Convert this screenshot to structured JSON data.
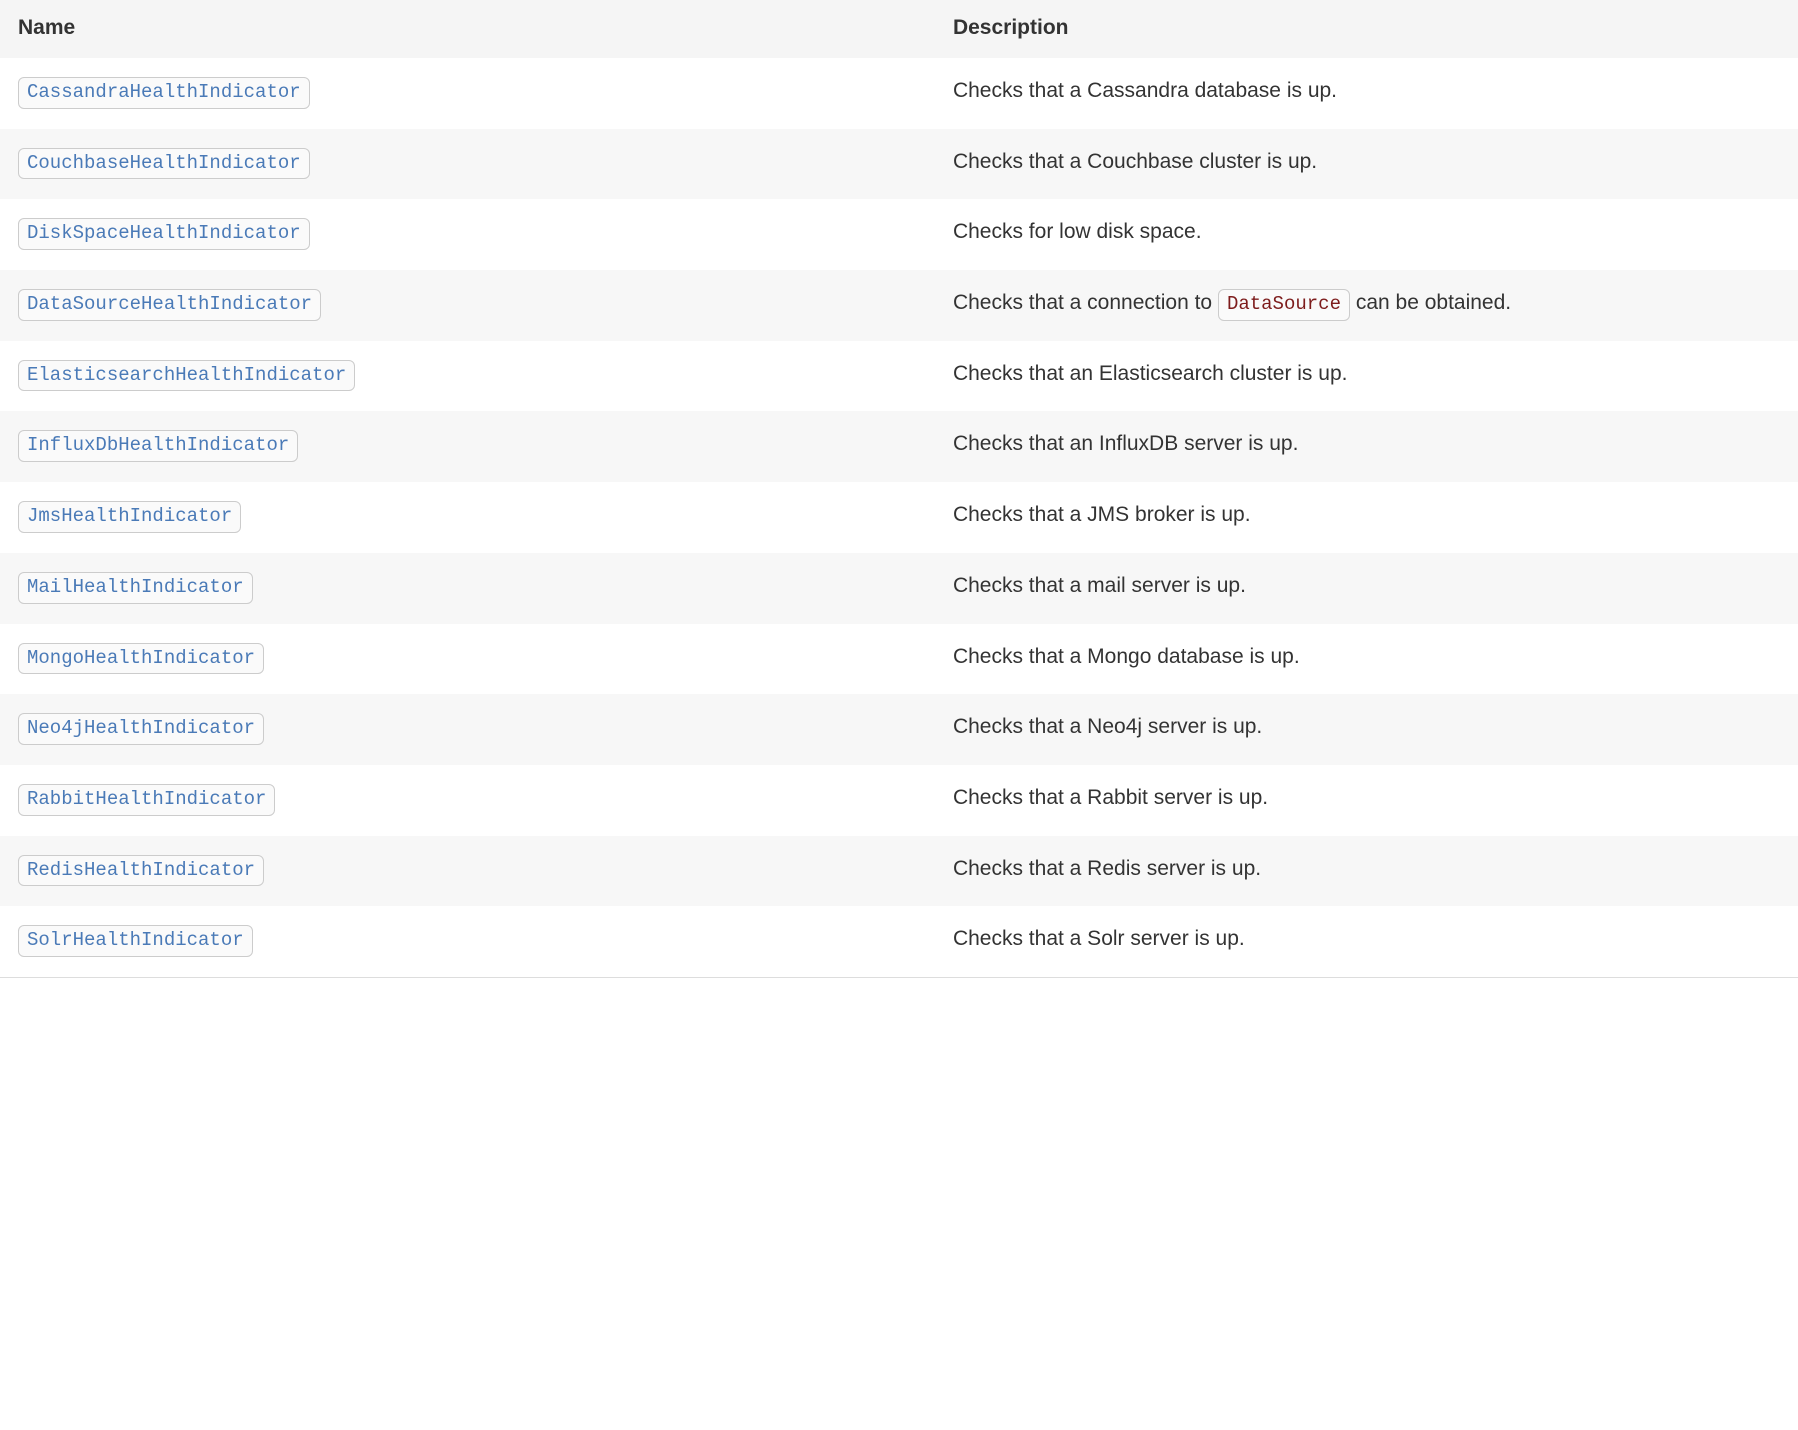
{
  "table": {
    "headers": {
      "name": "Name",
      "description": "Description"
    },
    "rows": [
      {
        "name": "CassandraHealthIndicator",
        "desc_parts": [
          {
            "kind": "text",
            "value": "Checks that a Cassandra database is up."
          }
        ]
      },
      {
        "name": "CouchbaseHealthIndicator",
        "desc_parts": [
          {
            "kind": "text",
            "value": "Checks that a Couchbase cluster is up."
          }
        ]
      },
      {
        "name": "DiskSpaceHealthIndicator",
        "desc_parts": [
          {
            "kind": "text",
            "value": "Checks for low disk space."
          }
        ]
      },
      {
        "name": "DataSourceHealthIndicator",
        "desc_parts": [
          {
            "kind": "text",
            "value": "Checks that a connection to "
          },
          {
            "kind": "code",
            "value": "DataSource"
          },
          {
            "kind": "text",
            "value": " can be obtained."
          }
        ]
      },
      {
        "name": "ElasticsearchHealthIndicator",
        "desc_parts": [
          {
            "kind": "text",
            "value": "Checks that an Elasticsearch cluster is up."
          }
        ]
      },
      {
        "name": "InfluxDbHealthIndicator",
        "desc_parts": [
          {
            "kind": "text",
            "value": "Checks that an InfluxDB server is up."
          }
        ]
      },
      {
        "name": "JmsHealthIndicator",
        "desc_parts": [
          {
            "kind": "text",
            "value": "Checks that a JMS broker is up."
          }
        ]
      },
      {
        "name": "MailHealthIndicator",
        "desc_parts": [
          {
            "kind": "text",
            "value": "Checks that a mail server is up."
          }
        ]
      },
      {
        "name": "MongoHealthIndicator",
        "desc_parts": [
          {
            "kind": "text",
            "value": "Checks that a Mongo database is up."
          }
        ]
      },
      {
        "name": "Neo4jHealthIndicator",
        "desc_parts": [
          {
            "kind": "text",
            "value": "Checks that a Neo4j server is up."
          }
        ]
      },
      {
        "name": "RabbitHealthIndicator",
        "desc_parts": [
          {
            "kind": "text",
            "value": "Checks that a Rabbit server is up."
          }
        ]
      },
      {
        "name": "RedisHealthIndicator",
        "desc_parts": [
          {
            "kind": "text",
            "value": "Checks that a Redis server is up."
          }
        ]
      },
      {
        "name": "SolrHealthIndicator",
        "desc_parts": [
          {
            "kind": "text",
            "value": "Checks that a Solr server is up."
          }
        ]
      }
    ]
  }
}
